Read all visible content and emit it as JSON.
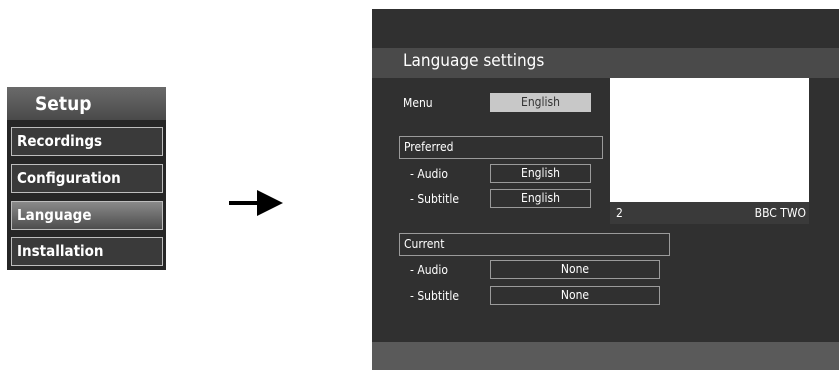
{
  "setup_menu": {
    "title": "Setup",
    "items": [
      {
        "label": "Recordings",
        "selected": false
      },
      {
        "label": "Configuration",
        "selected": false
      },
      {
        "label": "Language",
        "selected": true
      },
      {
        "label": "Installation",
        "selected": false
      }
    ]
  },
  "screen": {
    "title": "Language settings",
    "menu": {
      "label": "Menu",
      "value": "English"
    },
    "preferred": {
      "heading": "Preferred",
      "audio": {
        "label": "- Audio",
        "value": "English"
      },
      "subtitle": {
        "label": "- Subtitle",
        "value": "English"
      }
    },
    "current": {
      "heading": "Current",
      "audio": {
        "label": "- Audio",
        "value": "None"
      },
      "subtitle": {
        "label": "- Subtitle",
        "value": "None"
      }
    },
    "preview": {
      "channel_number": "2",
      "channel_name": "BBC TWO"
    }
  },
  "colors": {
    "screen_bg": "#303030",
    "header_bg": "#4a4a4a",
    "highlight": "#c8c8c8"
  }
}
